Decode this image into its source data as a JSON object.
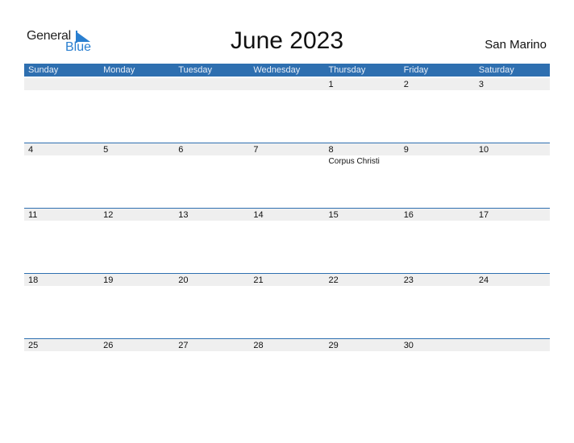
{
  "logo": {
    "general": "General",
    "blue": "Blue"
  },
  "title": "June 2023",
  "country": "San Marino",
  "colors": {
    "header_bg": "#2e6fb0",
    "date_strip": "#efefef",
    "logo_blue": "#2a7fd0"
  },
  "weekdays": [
    "Sunday",
    "Monday",
    "Tuesday",
    "Wednesday",
    "Thursday",
    "Friday",
    "Saturday"
  ],
  "weeks": [
    {
      "days": [
        {
          "n": "",
          "e": ""
        },
        {
          "n": "",
          "e": ""
        },
        {
          "n": "",
          "e": ""
        },
        {
          "n": "",
          "e": ""
        },
        {
          "n": "1",
          "e": ""
        },
        {
          "n": "2",
          "e": ""
        },
        {
          "n": "3",
          "e": ""
        }
      ]
    },
    {
      "days": [
        {
          "n": "4",
          "e": ""
        },
        {
          "n": "5",
          "e": ""
        },
        {
          "n": "6",
          "e": ""
        },
        {
          "n": "7",
          "e": ""
        },
        {
          "n": "8",
          "e": "Corpus Christi"
        },
        {
          "n": "9",
          "e": ""
        },
        {
          "n": "10",
          "e": ""
        }
      ]
    },
    {
      "days": [
        {
          "n": "11",
          "e": ""
        },
        {
          "n": "12",
          "e": ""
        },
        {
          "n": "13",
          "e": ""
        },
        {
          "n": "14",
          "e": ""
        },
        {
          "n": "15",
          "e": ""
        },
        {
          "n": "16",
          "e": ""
        },
        {
          "n": "17",
          "e": ""
        }
      ]
    },
    {
      "days": [
        {
          "n": "18",
          "e": ""
        },
        {
          "n": "19",
          "e": ""
        },
        {
          "n": "20",
          "e": ""
        },
        {
          "n": "21",
          "e": ""
        },
        {
          "n": "22",
          "e": ""
        },
        {
          "n": "23",
          "e": ""
        },
        {
          "n": "24",
          "e": ""
        }
      ]
    },
    {
      "days": [
        {
          "n": "25",
          "e": ""
        },
        {
          "n": "26",
          "e": ""
        },
        {
          "n": "27",
          "e": ""
        },
        {
          "n": "28",
          "e": ""
        },
        {
          "n": "29",
          "e": ""
        },
        {
          "n": "30",
          "e": ""
        },
        {
          "n": "",
          "e": ""
        }
      ]
    }
  ]
}
